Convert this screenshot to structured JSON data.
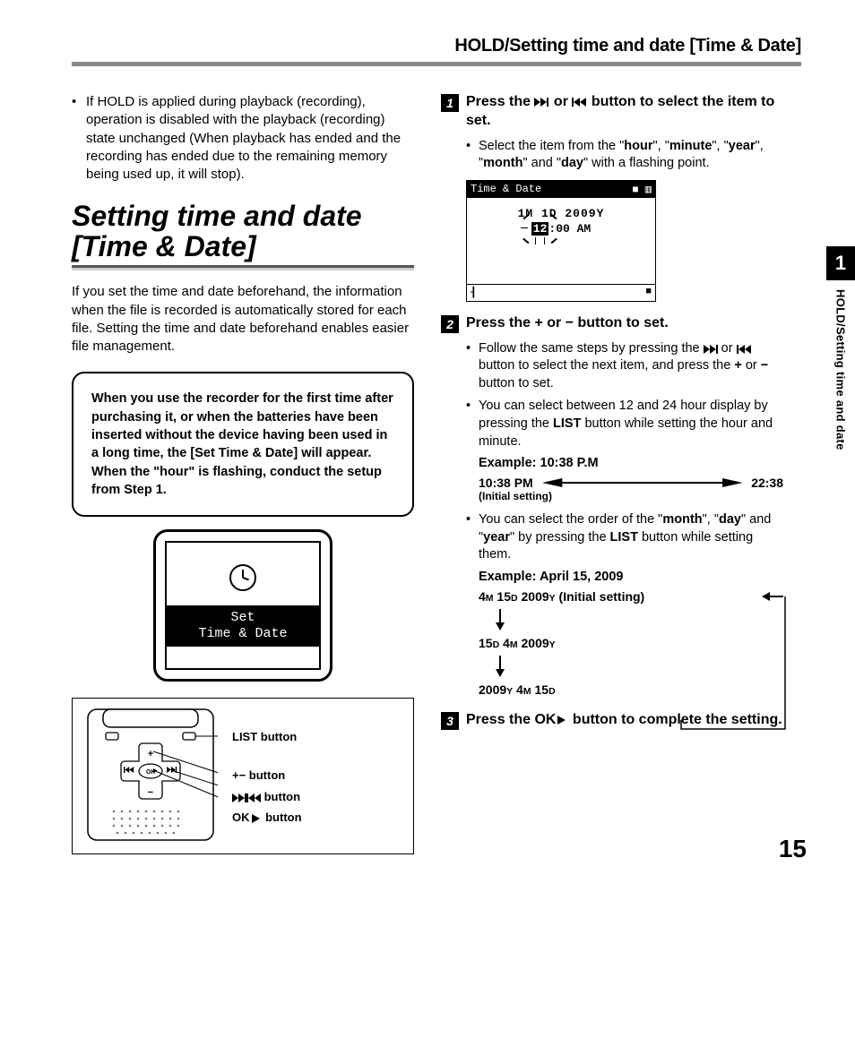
{
  "header": {
    "title": "HOLD/Setting time and date [Time & Date]"
  },
  "left": {
    "hold_note": "If HOLD is applied during playback (recording), operation is disabled with the playback (recording) state unchanged (When playback has ended and the recording has ended due to the remaining memory being used up, it will stop).",
    "section_heading": "Setting time and date [Time & Date]",
    "intro": "If you set the time and date beforehand, the information when the file is recorded is automatically stored for each file. Setting the time and date beforehand enables easier file management.",
    "notice_pre": "When you use the recorder for the first time after purchasing it, or when the batteries have been inserted without the device having been used in a long time, the [",
    "notice_bold": "Set Time & Date",
    "notice_post": "] will appear. When the \"hour\" is flashing, conduct the setup from Step 1.",
    "lcd_line1": "Set",
    "lcd_line2": "Time & Date",
    "dev_labels": {
      "list_pre": "LIST",
      "list_post": " button",
      "plusminus": "+− button",
      "seek_post": " button",
      "ok_pre": "OK",
      "ok_post": " button"
    }
  },
  "right": {
    "step1": {
      "pre": "Press the ",
      "mid": " or ",
      "post": " button to select the item to set.",
      "bullet_pre": "Select the item from the \"",
      "i1": "hour",
      "s1": "\", \"",
      "i2": "minute",
      "s2": "\", \"",
      "i3": "year",
      "s3": "\", \"",
      "i4": "month",
      "s4": "\" and \"",
      "i5": "day",
      "s5": "\" with a flashing point."
    },
    "screen": {
      "title": "Time & Date",
      "stopicon": "■",
      "batt": "▥",
      "date": "1M 1D  2009Y",
      "time_hl": "12",
      "time_rest": ":00 AM",
      "bl": "┨",
      "br": "■"
    },
    "step2": {
      "head_pre": "Press the ",
      "head_p": "+",
      "head_or": " or ",
      "head_m": "−",
      "head_post": " button to set.",
      "b1_pre": "Follow the same steps by pressing the ",
      "b1_mid": " or ",
      "b1_mid2": " button to select the next item, and press the ",
      "b1_p": "+",
      "b1_or": " or ",
      "b1_m": "−",
      "b1_post": " button to set.",
      "b2_pre": "You can select between 12 and 24 hour display by pressing the ",
      "b2_list": "LIST",
      "b2_post": " button while setting the hour and minute.",
      "ex1": "Example: 10:38 P.M",
      "t12": "10:38 PM",
      "t12_note": "(Initial setting)",
      "t24": "22:38",
      "b3_pre": "You can select the order of the \"",
      "b3_m": "month",
      "b3_s1": "\", \"",
      "b3_d": "day",
      "b3_s2": "\" and \"",
      "b3_y": "year",
      "b3_s3": "\" by pressing the ",
      "b3_list": "LIST",
      "b3_post": " button while setting them.",
      "ex2": "Example: April 15, 2009",
      "order1_a": "4",
      "order1_as": "M",
      "order1_b": " 15",
      "order1_bs": "D",
      "order1_c": " 2009",
      "order1_cs": "Y",
      "order1_note": " (Initial setting)",
      "order2_a": "15",
      "order2_as": "D",
      "order2_b": " 4",
      "order2_bs": "M",
      "order2_c": " 2009",
      "order2_cs": "Y",
      "order3_a": "2009",
      "order3_as": "Y",
      "order3_b": " 4",
      "order3_bs": "M",
      "order3_c": " 15",
      "order3_cs": "D"
    },
    "step3": {
      "pre": "Press the ",
      "ok": "OK",
      "post": " button to complete the setting."
    }
  },
  "side": {
    "chapter": "1",
    "label": "HOLD/Setting time and date"
  },
  "page_number": "15"
}
